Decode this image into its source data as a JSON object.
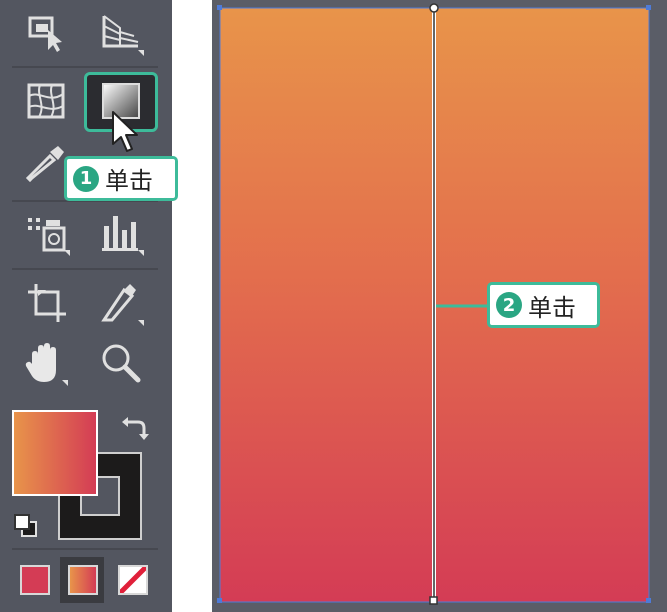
{
  "toolbar": {
    "tools": [
      {
        "name": "artboard-select-tool",
        "icon": "artboard-cursor-icon"
      },
      {
        "name": "perspective-grid-tool",
        "icon": "perspective-grid-icon"
      },
      {
        "name": "mesh-tool",
        "icon": "mesh-icon"
      },
      {
        "name": "gradient-tool",
        "icon": "gradient-icon"
      },
      {
        "name": "eyedropper-tool",
        "icon": "eyedropper-icon"
      },
      {
        "name": "symbol-sprayer-tool",
        "icon": "spray-can-icon"
      },
      {
        "name": "column-graph-tool",
        "icon": "bar-graph-icon"
      },
      {
        "name": "crop-artboard-tool",
        "icon": "crop-icon"
      },
      {
        "name": "slice-knife-tool",
        "icon": "knife-icon"
      },
      {
        "name": "hand-tool",
        "icon": "hand-icon"
      },
      {
        "name": "zoom-tool",
        "icon": "magnifier-icon"
      }
    ],
    "fill_gradient_colors": [
      "#e8944a",
      "#d43c55"
    ],
    "swatch_modes": [
      "color",
      "gradient",
      "none"
    ]
  },
  "colors": {
    "accent": "#3dbb9a",
    "callout_number_bg": "#2aa683",
    "gradient_top": "#e8944a",
    "gradient_bottom": "#d43c55",
    "toolbar_bg": "#535660"
  },
  "callouts": [
    {
      "number": "1",
      "text": "单击"
    },
    {
      "number": "2",
      "text": "单击"
    }
  ]
}
